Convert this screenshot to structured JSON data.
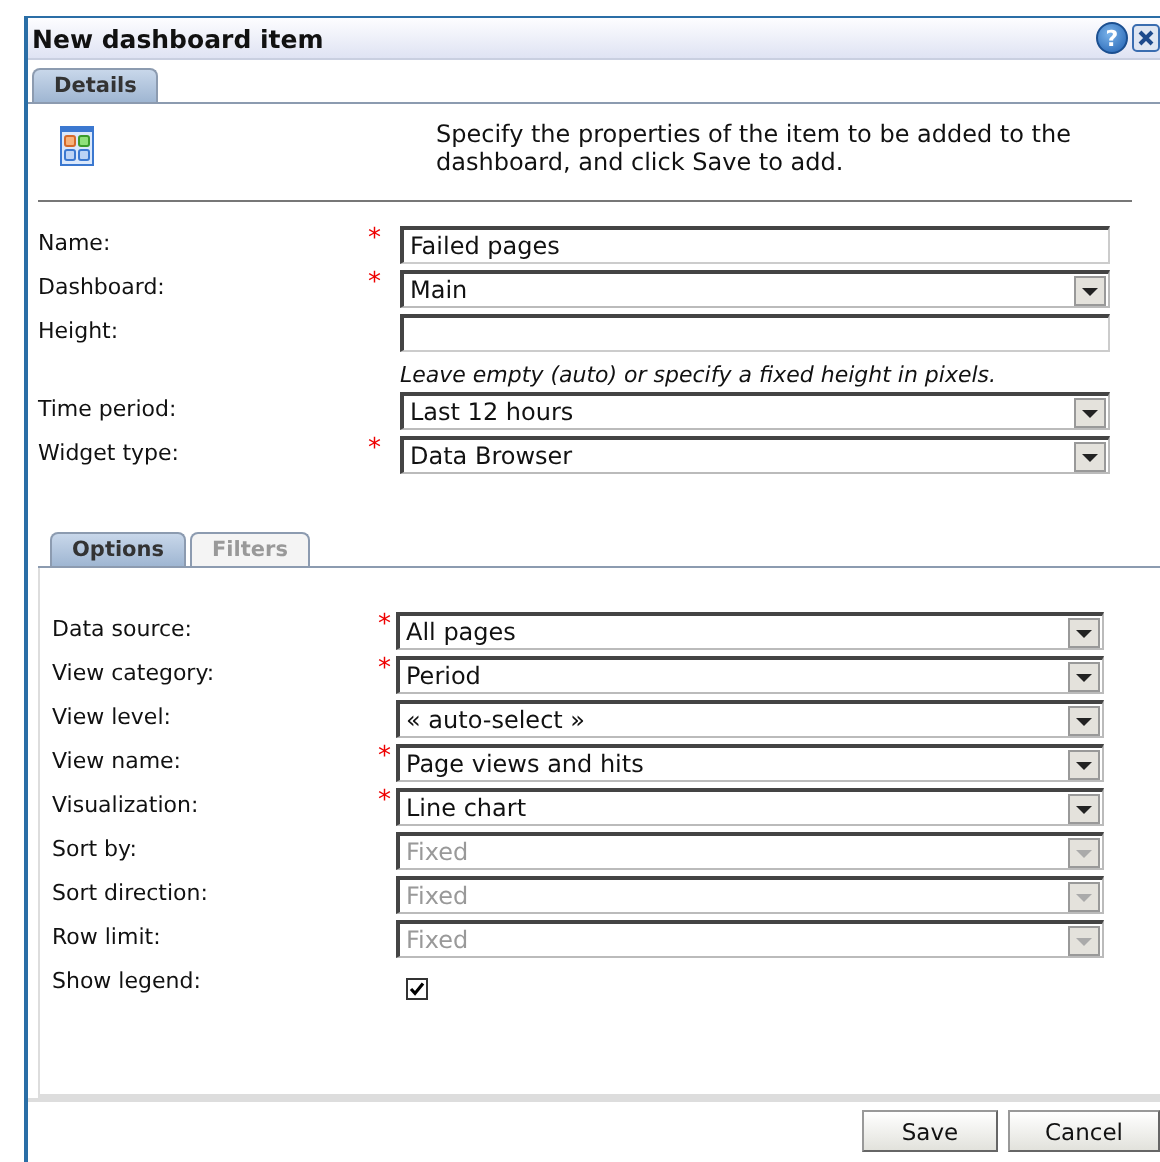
{
  "window": {
    "title": "New dashboard item",
    "help_button": "?"
  },
  "tabs": [
    {
      "label": "Details",
      "selected": true
    }
  ],
  "description": "Specify the properties of the item to be added to the dashboard, and click Save to add.",
  "fields": [
    {
      "kind": "text",
      "label": "Name:",
      "required": true,
      "value": "Failed pages"
    },
    {
      "kind": "select",
      "label": "Dashboard:",
      "required": true,
      "value": "Main"
    },
    {
      "kind": "text",
      "label": "Height:",
      "required": false,
      "hint": "Leave empty (auto) or specify a fixed height in pixels."
    },
    {
      "kind": "select",
      "label": "Time period:",
      "required": false,
      "value": "Last 12 hours"
    },
    {
      "kind": "select",
      "label": "Widget type:",
      "required": true,
      "value": "Data Browser"
    }
  ],
  "options_tabs": [
    {
      "label": "Options",
      "selected": true
    },
    {
      "label": "Filters",
      "selected": false
    }
  ],
  "options": [
    {
      "kind": "select",
      "label": "Data source:",
      "required": true,
      "disabled": false,
      "value": "All pages"
    },
    {
      "kind": "select",
      "label": "View category:",
      "required": true,
      "disabled": false,
      "value": "Period"
    },
    {
      "kind": "select",
      "label": "View level:",
      "required": false,
      "disabled": false,
      "value": "« auto-select »"
    },
    {
      "kind": "select",
      "label": "View name:",
      "required": true,
      "disabled": false,
      "value": "Page views and hits"
    },
    {
      "kind": "select",
      "label": "Visualization:",
      "required": true,
      "disabled": false,
      "value": "Line chart"
    },
    {
      "kind": "select",
      "label": "Sort by:",
      "required": false,
      "disabled": true,
      "value": "Fixed"
    },
    {
      "kind": "select",
      "label": "Sort direction:",
      "required": false,
      "disabled": true,
      "value": "Fixed"
    },
    {
      "kind": "select",
      "label": "Row limit:",
      "required": false,
      "disabled": true,
      "value": "Fixed"
    },
    {
      "kind": "checkbox",
      "label": "Show legend:",
      "required": false,
      "checked": true
    }
  ],
  "buttons": [
    "Save",
    "Cancel"
  ],
  "required_marker": "*"
}
